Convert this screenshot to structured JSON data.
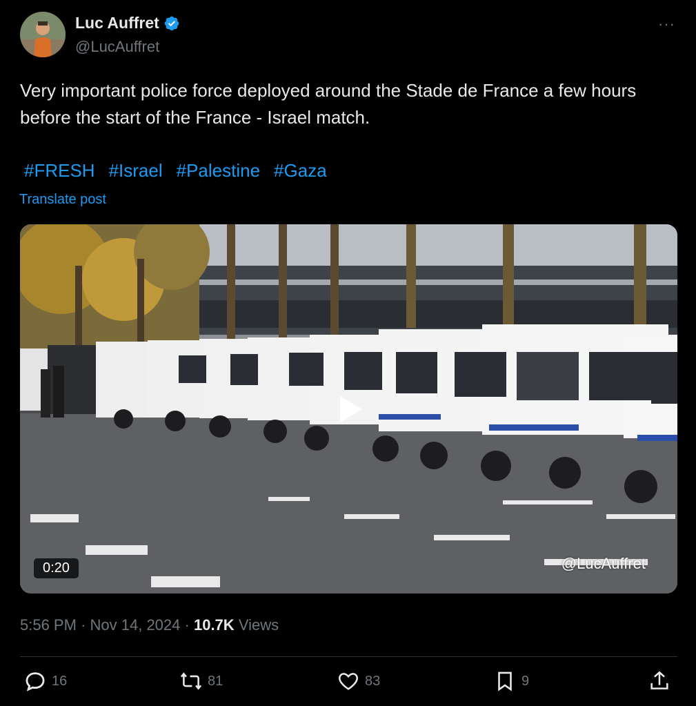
{
  "author": {
    "display_name": "Luc Auffret",
    "handle": "@LucAuffret",
    "verified": true
  },
  "more_menu": "···",
  "post": {
    "text": "Very important police force deployed around the Stade de France a few hours before the start of the France - Israel match.",
    "hashtags": [
      "#FRESH",
      "#Israel",
      "#Palestine",
      "#Gaza"
    ],
    "translate_label": "Translate post"
  },
  "video": {
    "duration": "0:20",
    "watermark": "@LucAuffret"
  },
  "meta": {
    "time": "5:56 PM",
    "separator": "·",
    "date": "Nov 14, 2024",
    "views_count": "10.7K",
    "views_label": "Views"
  },
  "actions": {
    "replies": "16",
    "reposts": "81",
    "likes": "83",
    "bookmarks": "9"
  },
  "colors": {
    "background": "#000000",
    "text": "#e7e9ea",
    "secondary": "#71767b",
    "accent": "#1d9bf0"
  }
}
